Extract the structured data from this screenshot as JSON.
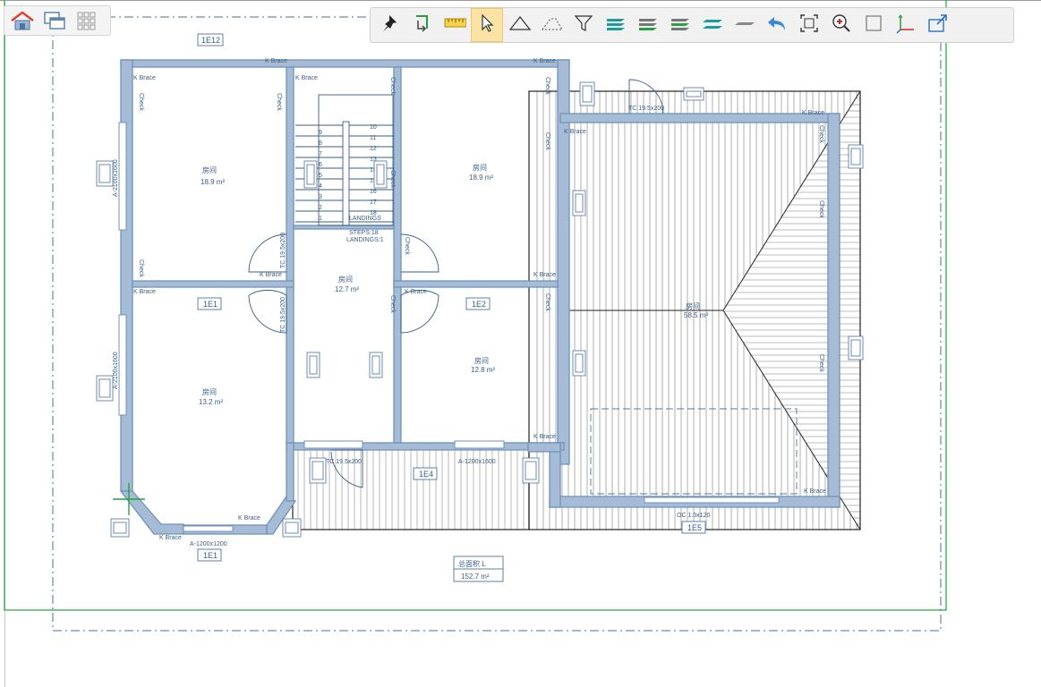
{
  "view_switcher": [
    {
      "name": "house-3d-icon"
    },
    {
      "name": "stacked-windows-icon"
    },
    {
      "name": "grid-icon"
    }
  ],
  "toolbar": [
    {
      "name": "pin-icon",
      "active": false
    },
    {
      "name": "rotate-corner-icon",
      "active": false
    },
    {
      "name": "ruler-icon",
      "active": false
    },
    {
      "name": "select-arrow-icon",
      "active": true
    },
    {
      "name": "triangle-icon",
      "active": false
    },
    {
      "name": "dashed-roof-icon",
      "active": false
    },
    {
      "name": "filter-icon",
      "active": false
    },
    {
      "name": "layers-teal-icon",
      "active": false
    },
    {
      "name": "layers-green-icon",
      "active": false
    },
    {
      "name": "layers-gray-green-icon",
      "active": false
    },
    {
      "name": "parallel-planes-icon",
      "active": false
    },
    {
      "name": "flat-plane-icon",
      "active": false
    },
    {
      "name": "undo-arrow-icon",
      "active": false
    },
    {
      "name": "fit-view-icon",
      "active": false
    },
    {
      "name": "zoom-in-icon",
      "active": false
    },
    {
      "name": "square-view-icon",
      "active": false
    },
    {
      "name": "axes-icon",
      "active": false
    },
    {
      "name": "export-box-icon",
      "active": false
    }
  ],
  "plan": {
    "colors": {
      "wall": "#6f93bb",
      "wall_fill": "#a6bcd6",
      "label": "#3a5f84",
      "green": "#23a33a",
      "roof_line": "#555555"
    },
    "wall_labels": {
      "k_brace": "K Brace",
      "check": "Check",
      "window_right": "A-2100x1600",
      "window_left": "A-2100x1600",
      "window_bottom_center": "A-1200x1600",
      "window_bottom_left": "A-1200x1200",
      "door_top": "TC 19.5x200",
      "door_bottom": "TC 19.5x200",
      "opening_bottom": "OC 1.5x120",
      "side_opening_1": "TC 19.5x200",
      "side_opening_2": "TC 19.5x200"
    },
    "stair_labels": {
      "line1": "LANDINGS",
      "line2": "STEPS:18",
      "line3": "LANDINGS:1"
    },
    "stair_numbers": [
      "1",
      "2",
      "3",
      "4",
      "5",
      "6",
      "7",
      "8",
      "9",
      "10",
      "11",
      "12",
      "13",
      "14",
      "15",
      "16",
      "17",
      "18"
    ],
    "tags": {
      "top": "1E12",
      "room_tl": "1E1",
      "room_tr": "1E2",
      "room_bottom": "1E4",
      "bottom_left": "1E1",
      "bottom_right": "1E5"
    },
    "rooms": [
      {
        "name": "房间",
        "area": "18.9 m²"
      },
      {
        "name": "房间",
        "area": "18.9 m²"
      },
      {
        "name": "房间",
        "area": "12.7 m²"
      },
      {
        "name": "房间",
        "area": "12.8 m²"
      },
      {
        "name": "房间",
        "area": "13.2 m²"
      },
      {
        "name": "房间",
        "area": "58.5 m²"
      }
    ],
    "total_area": {
      "label": "总面积 L",
      "value": "152.7 m²"
    }
  }
}
